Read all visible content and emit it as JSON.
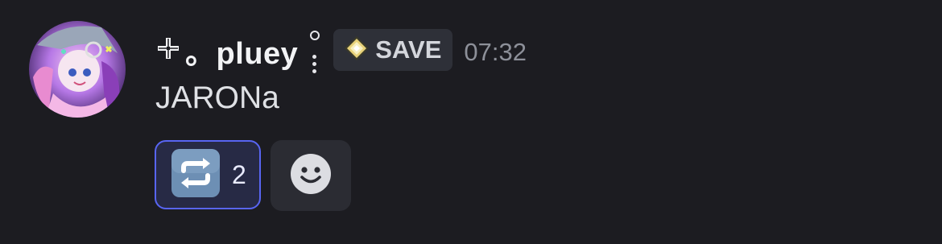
{
  "message": {
    "username": "。pluey",
    "tag_label": "SAVE",
    "timestamp": "07:32",
    "content": "JARONa"
  },
  "reactions": [
    {
      "icon": "repeat-arrows-emoji-icon",
      "count": "2",
      "selected": true
    }
  ],
  "add_reaction_icon": "smiley-icon",
  "colors": {
    "background": "#1c1c21",
    "accent": "#5865f2",
    "username": "#f2f3f5",
    "timestamp": "#8d9099"
  }
}
